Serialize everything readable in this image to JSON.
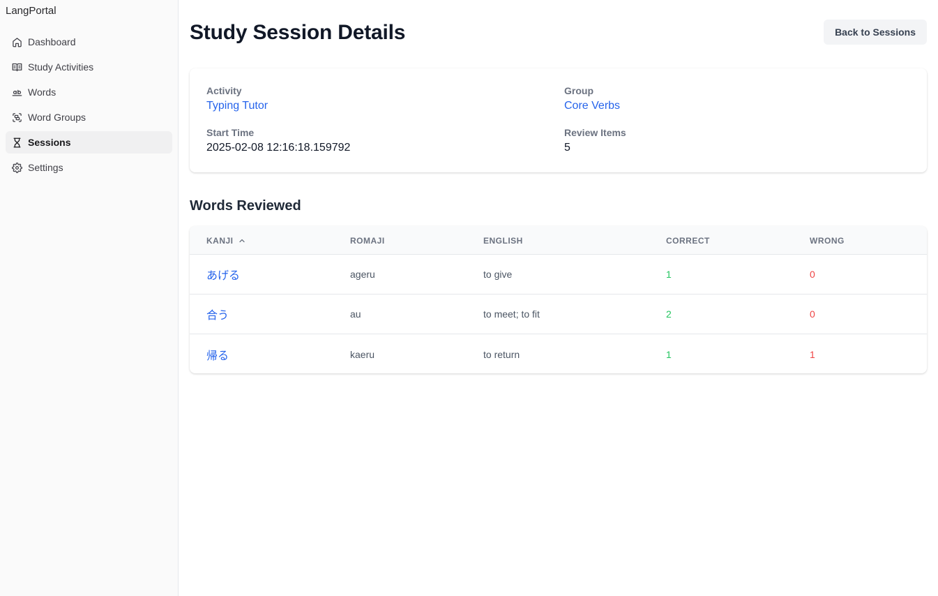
{
  "app": {
    "brand": "LangPortal"
  },
  "sidebar": {
    "items": [
      {
        "label": "Dashboard",
        "icon": "home-icon",
        "active": false
      },
      {
        "label": "Study Activities",
        "icon": "book-open-icon",
        "active": false
      },
      {
        "label": "Words",
        "icon": "whole-word-icon",
        "active": false
      },
      {
        "label": "Word Groups",
        "icon": "group-scan-icon",
        "active": false
      },
      {
        "label": "Sessions",
        "icon": "hourglass-icon",
        "active": true
      },
      {
        "label": "Settings",
        "icon": "gear-icon",
        "active": false
      }
    ]
  },
  "page": {
    "title": "Study Session Details",
    "back_button": "Back to Sessions"
  },
  "details": {
    "activity_label": "Activity",
    "activity_value": "Typing Tutor",
    "group_label": "Group",
    "group_value": "Core Verbs",
    "start_time_label": "Start Time",
    "start_time_value": "2025-02-08 12:16:18.159792",
    "review_items_label": "Review Items",
    "review_items_value": "5"
  },
  "words_reviewed": {
    "title": "Words Reviewed",
    "columns": [
      "KANJI",
      "ROMAJI",
      "ENGLISH",
      "CORRECT",
      "WRONG"
    ],
    "sort": {
      "column": "KANJI",
      "direction": "asc",
      "icon": "chevron-up-icon"
    },
    "rows": [
      {
        "kanji": "あげる",
        "romaji": "ageru",
        "english": "to give",
        "correct": "1",
        "wrong": "0"
      },
      {
        "kanji": "合う",
        "romaji": "au",
        "english": "to meet; to fit",
        "correct": "2",
        "wrong": "0"
      },
      {
        "kanji": "帰る",
        "romaji": "kaeru",
        "english": "to return",
        "correct": "1",
        "wrong": "1"
      }
    ]
  },
  "colors": {
    "link": "#2563eb",
    "correct": "#22c55e",
    "wrong": "#ef4444",
    "muted": "#6b7280",
    "sidebar_bg": "#fafafa"
  }
}
